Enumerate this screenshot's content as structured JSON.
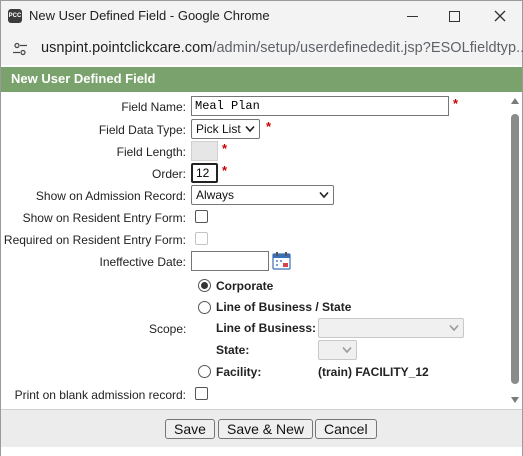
{
  "window": {
    "title": "New User Defined Field - Google Chrome",
    "app_icon_text": "PCC",
    "url_host": "usnpint.pointclickcare.com",
    "url_path": "/admin/setup/userdefinededit.jsp?ESOLfieldtyp..."
  },
  "dialog": {
    "title": "New User Defined Field"
  },
  "form": {
    "field_name": {
      "label": "Field Name:",
      "value": "Meal Plan"
    },
    "field_data_type": {
      "label": "Field Data Type:",
      "value": "Pick List"
    },
    "field_length": {
      "label": "Field Length:",
      "value": ""
    },
    "order": {
      "label": "Order:",
      "value": "12"
    },
    "show_on_admission": {
      "label": "Show on Admission Record:",
      "value": "Always"
    },
    "show_on_resident_entry": {
      "label": "Show on Resident Entry Form:",
      "checked": false
    },
    "required_on_resident_entry": {
      "label": "Required on Resident Entry Form:",
      "checked": false,
      "disabled": true
    },
    "ineffective_date": {
      "label": "Ineffective Date:",
      "value": ""
    },
    "scope": {
      "label": "Scope:",
      "corporate_label": "Corporate",
      "corporate_checked": true,
      "lob_state_label": "Line of Business / State",
      "lob_label": "Line of Business:",
      "lob_value": "",
      "state_label": "State:",
      "state_value": "",
      "facility_label": "Facility:",
      "facility_value": "(train) FACILITY_12"
    },
    "print_on_blank": {
      "label": "Print on blank admission record:",
      "checked": false
    }
  },
  "required_mark": "*",
  "buttons": {
    "save": "Save",
    "save_new": "Save & New",
    "cancel": "Cancel"
  }
}
